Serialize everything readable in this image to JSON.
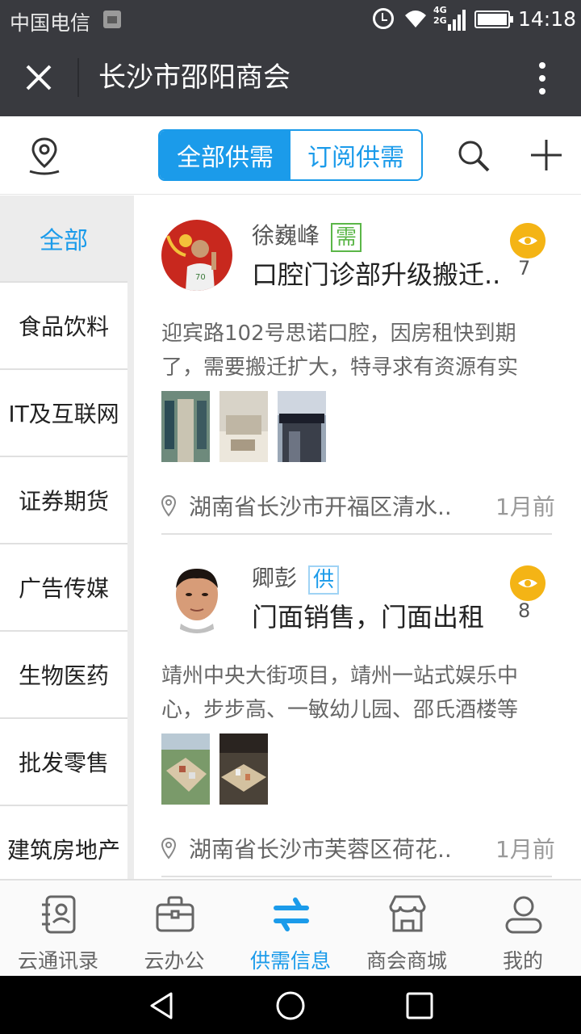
{
  "status_bar": {
    "carrier": "中国电信",
    "network": "4G\n2G",
    "time": "14:18"
  },
  "title_bar": {
    "title": "长沙市邵阳商会"
  },
  "toolbar": {
    "segments": [
      "全部供需",
      "订阅供需"
    ],
    "active_segment": 0
  },
  "sidebar": {
    "items": [
      "全部",
      "食品饮料",
      "IT及互联网",
      "证券期货",
      "广告传媒",
      "生物医药",
      "批发零售",
      "建筑房地产"
    ],
    "active_index": 0
  },
  "feed": [
    {
      "author": "徐巍峰",
      "tag": "需",
      "title": "口腔门诊部升级搬迁..",
      "views": "7",
      "description": "迎宾路102号思诺口腔，因房租快到期了，需要搬迁扩大，特寻求有资源有实",
      "address": "湖南省长沙市开福区清水..",
      "time_ago": "1月前"
    },
    {
      "author": "卿彭",
      "tag": "供",
      "title": "门面销售，门面出租",
      "views": "8",
      "description": "靖州中央大街项目，靖州一站式娱乐中心，步步高、一敏幼儿园、邵氏酒楼等",
      "address": "湖南省长沙市芙蓉区荷花..",
      "time_ago": "1月前"
    }
  ],
  "tab_bar": {
    "tabs": [
      "云通讯录",
      "云办公",
      "供需信息",
      "商会商城",
      "我的"
    ],
    "active_index": 2
  },
  "colors": {
    "accent": "#1b9bea",
    "header_bg": "#393a3f",
    "need_tag": "#5bb648",
    "views_badge": "#f4b415"
  },
  "icons": {
    "toolbar": [
      "location-icon",
      "search-icon",
      "plus-icon"
    ],
    "title_bar": [
      "close-icon",
      "more-icon"
    ],
    "tabs": [
      "contacts-icon",
      "briefcase-icon",
      "exchange-icon",
      "store-icon",
      "profile-icon"
    ],
    "nav": [
      "back-icon",
      "home-icon",
      "recents-icon"
    ]
  }
}
